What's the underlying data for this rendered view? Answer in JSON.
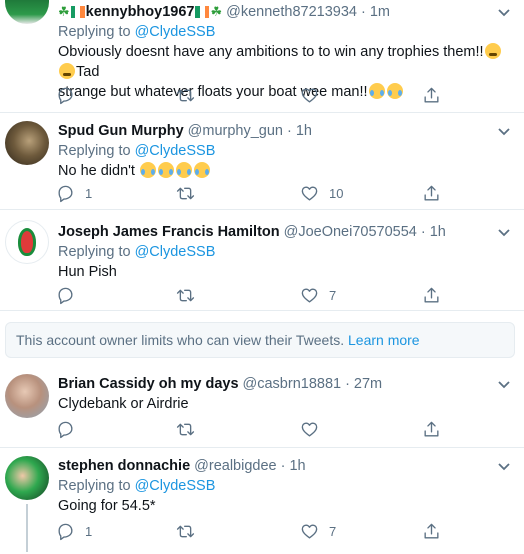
{
  "tweets": [
    {
      "name": "kennybhoy1967",
      "handle": "@kenneth87213934",
      "time": "1m",
      "reply_prefix": "Replying to",
      "reply_to": "@ClydeSSB",
      "text_line1": "Obviously doesnt have any ambitions to to win any trophies them!!",
      "text_line1_end": "Tad",
      "text_line2": "strange but whatever floats your boat wee man!!",
      "reply_count": "",
      "retweet_count": "",
      "like_count": ""
    },
    {
      "name": "Spud Gun Murphy",
      "handle": "@murphy_gun",
      "time": "1h",
      "reply_prefix": "Replying to",
      "reply_to": "@ClydeSSB",
      "text": "No he didn't",
      "reply_count": "1",
      "retweet_count": "",
      "like_count": "10"
    },
    {
      "name": "Joseph James Francis Hamilton",
      "handle": "@JoeOnei70570554",
      "time": "1h",
      "reply_prefix": "Replying to",
      "reply_to": "@ClydeSSB",
      "text": "Hun Pish",
      "reply_count": "",
      "retweet_count": "",
      "like_count": "7"
    },
    {
      "name": "Brian Cassidy oh my days",
      "handle": "@casbrn18881",
      "time": "27m",
      "text": "Clydebank or Airdrie",
      "reply_count": "",
      "retweet_count": "",
      "like_count": ""
    },
    {
      "name": "stephen donnachie",
      "handle": "@realbigdee",
      "time": "1h",
      "reply_prefix": "Replying to",
      "reply_to": "@ClydeSSB",
      "text": "Going for 54.5*",
      "reply_count": "1",
      "retweet_count": "",
      "like_count": "7"
    }
  ],
  "separator": "·",
  "notice": {
    "text": "This account owner limits who can view their Tweets.",
    "link": "Learn more"
  },
  "icons": [
    "reply-icon",
    "retweet-icon",
    "like-icon",
    "share-icon",
    "caret-down-icon"
  ],
  "colors": {
    "link": "#1b95e0",
    "muted": "#5b7083",
    "border": "#e6ecf0"
  }
}
